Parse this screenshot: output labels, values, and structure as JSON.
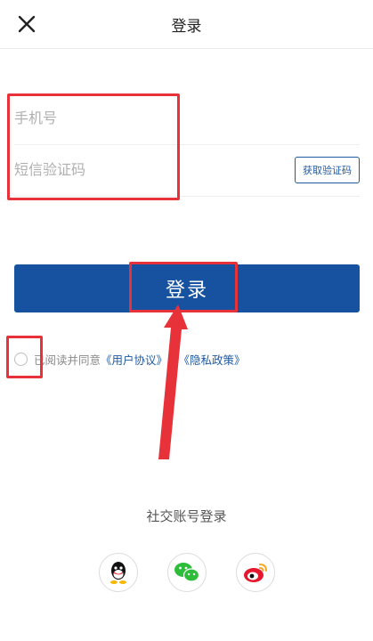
{
  "header": {
    "title": "登录"
  },
  "form": {
    "phone_placeholder": "手机号",
    "code_placeholder": "短信验证码",
    "get_code_label": "获取验证码",
    "login_label": "登录"
  },
  "agreement": {
    "prefix": "已阅读并同意",
    "user_agreement": "《用户协议》",
    "conjunction": "和",
    "privacy_policy": "《隐私政策》"
  },
  "social": {
    "title": "社交账号登录",
    "providers": [
      "qq-icon",
      "wechat-icon",
      "weibo-icon"
    ]
  },
  "colors": {
    "primary": "#1652a0",
    "link": "#1e5aa3",
    "annotation": "#e8323a"
  }
}
